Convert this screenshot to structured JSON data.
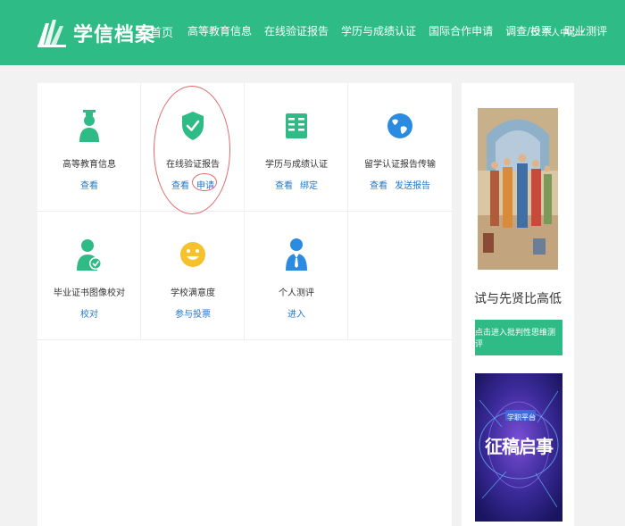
{
  "header": {
    "logo_text": "学信档案",
    "nav": [
      "首页",
      "高等教育信息",
      "在线验证报告",
      "学历与成绩认证",
      "国际合作申请",
      "调查/投票",
      "职业测评"
    ],
    "user_center": "个人中心"
  },
  "services": [
    {
      "title": "高等教育信息",
      "links": [
        "查看"
      ]
    },
    {
      "title": "在线验证报告",
      "links": [
        "查看",
        "申请"
      ]
    },
    {
      "title": "学历与成绩认证",
      "links": [
        "查看",
        "绑定"
      ]
    },
    {
      "title": "留学认证报告传输",
      "links": [
        "查看",
        "发送报告"
      ]
    },
    {
      "title": "毕业证书图像校对",
      "links": [
        "校对"
      ]
    },
    {
      "title": "学校满意度",
      "links": [
        "参与投票"
      ]
    },
    {
      "title": "个人测评",
      "links": [
        "进入"
      ]
    }
  ],
  "sidebar": {
    "title": "试与先贤比高低",
    "button": "点击进入批判性思维测评",
    "poster_tag": "学职平台",
    "poster_title": "征稿启事"
  },
  "colors": {
    "brand": "#2fbb86",
    "link": "#2477c9",
    "annotation": "#e06a6a"
  }
}
